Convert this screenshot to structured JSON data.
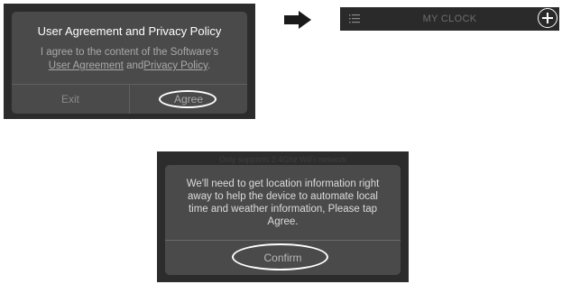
{
  "agreement_dialog": {
    "title": "User Agreement and Privacy Policy",
    "body_prefix": "I agree to the content of the Software's",
    "user_agreement_link": "User Agreement",
    "connector": "and",
    "privacy_policy_link": "Privacy Policy",
    "period": ".",
    "exit_label": "Exit",
    "agree_label": "Agree"
  },
  "app_header": {
    "title": "MY CLOCK",
    "menu_icon": "menu-icon",
    "add_icon": "add-circle-icon"
  },
  "location_dialog": {
    "top_hint": "Only supports 2.4Ghz WiFi network",
    "message": "We'll need to get location information right away to help the device to automate local time and weather information, Please tap Agree.",
    "confirm_label": "Confirm"
  },
  "colors": {
    "panel_bg": "#2c2c2c",
    "dialog_bg": "#4a4a4a",
    "highlight_ring": "#ffffff"
  }
}
